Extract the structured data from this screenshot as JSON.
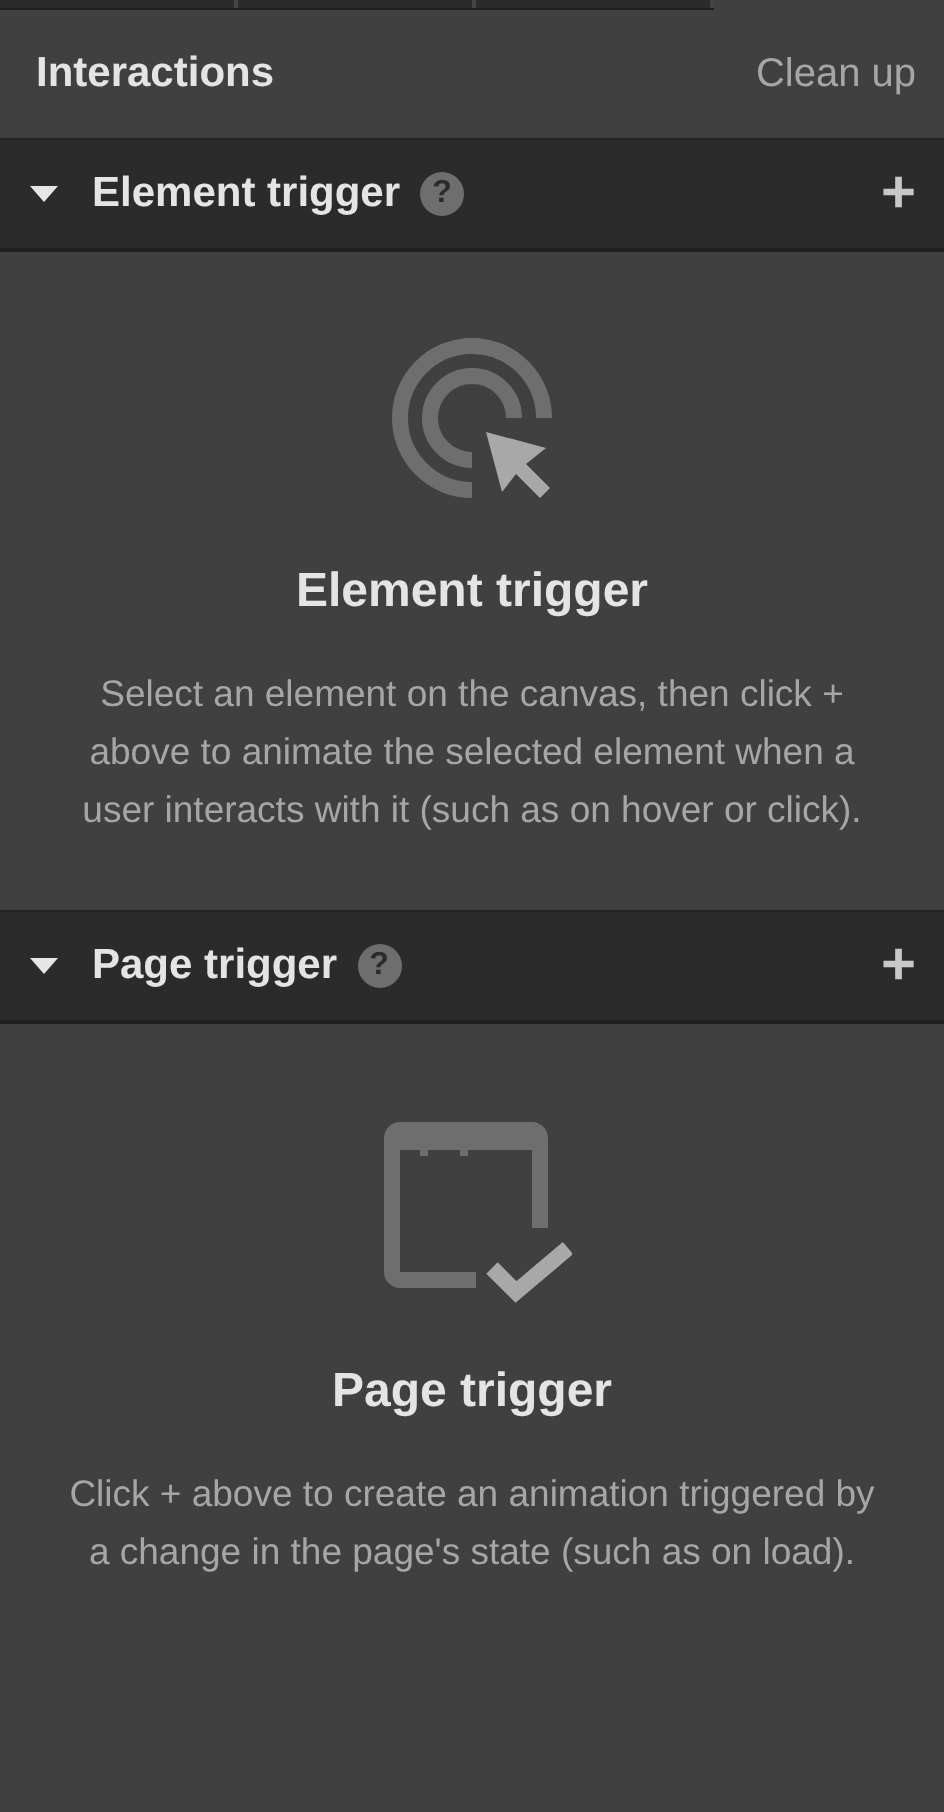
{
  "panel": {
    "title": "Interactions",
    "action": "Clean up"
  },
  "sections": [
    {
      "kind": "element",
      "title": "Element trigger",
      "help": "?",
      "add": "+",
      "expanded": true,
      "empty_title": "Element trigger",
      "empty_text": "Select an element on the canvas, then click + above to animate the selected element when a user interacts with it (such as on hover or click)."
    },
    {
      "kind": "page",
      "title": "Page trigger",
      "help": "?",
      "add": "+",
      "expanded": true,
      "empty_title": "Page trigger",
      "empty_text": "Click + above to create an animation triggered by a change in the page's state (such as on load)."
    }
  ]
}
